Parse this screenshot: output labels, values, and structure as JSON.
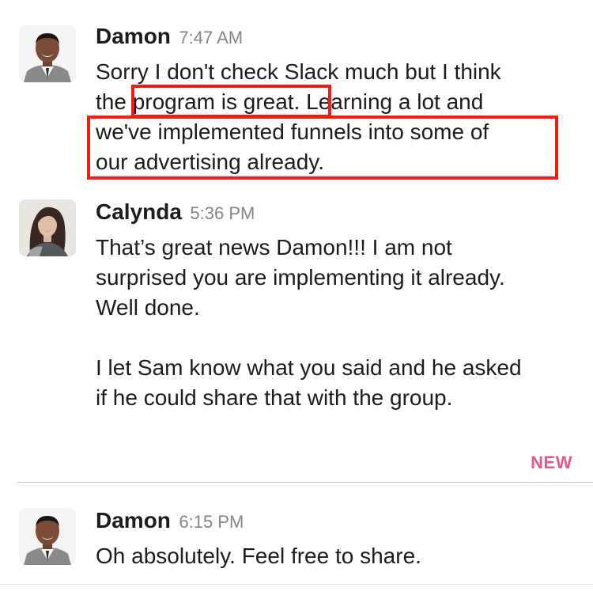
{
  "messages": [
    {
      "sender": "Damon",
      "time": "7:47 AM",
      "avatar": "damon-avatar",
      "lines": [
        "Sorry I don't check Slack much but I think",
        "the program is great. Learning a lot and",
        "we've implemented funnels into some of",
        "our advertising already."
      ]
    },
    {
      "sender": "Calynda",
      "time": "5:36 PM",
      "avatar": "calynda-avatar",
      "lines": [
        "That’s great news Damon!!! I am not",
        "surprised you are implementing it already.",
        "Well done.",
        "",
        "I let Sam know what you said and he asked",
        "if he could share that with the group."
      ]
    },
    {
      "sender": "Damon",
      "time": "6:15 PM",
      "avatar": "damon-avatar",
      "lines": [
        "Oh absolutely. Feel free to share."
      ]
    }
  ],
  "new_divider": {
    "label": "NEW",
    "color": "#e8578c"
  },
  "highlight_color": "#f21d0f"
}
